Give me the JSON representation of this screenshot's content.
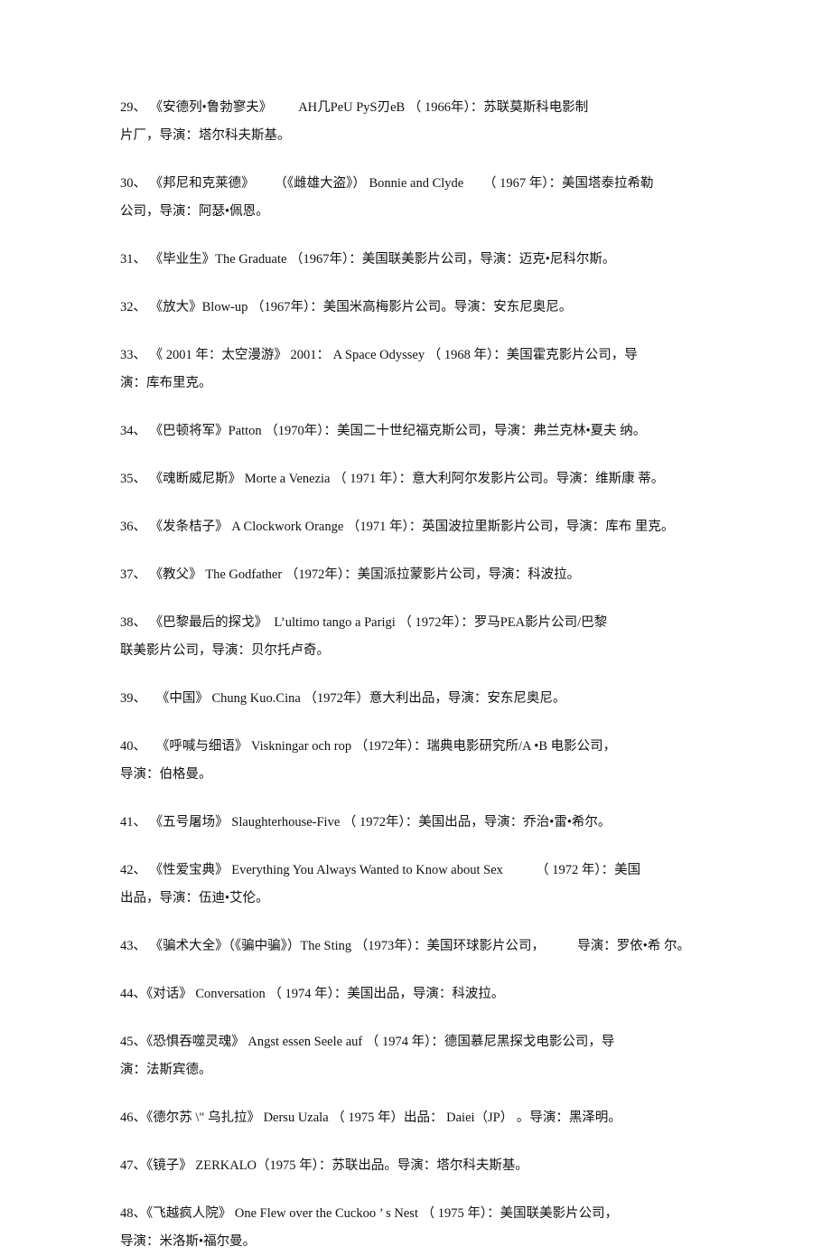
{
  "document": {
    "page_background": "#ffffff",
    "text_color": "#111111",
    "entries": [
      {
        "index": "29、",
        "title_cjk": "《安德列•鲁勃寥夫》",
        "title_latin": "AH几PeU PyS刃eB",
        "year": "（ 1966年）：",
        "line1": "29、 《安德列•鲁勃寥夫》        AH几PeU PyS刃eB （ 1966年）：苏联莫斯科电影制",
        "line2": "片厂，导演：塔尔科夫斯基。"
      },
      {
        "index": "30、",
        "title_cjk": "《邦尼和克莱德》",
        "alt_title_cjk": "（《雌雄大盗》）",
        "title_latin": "Bonnie and Clyde",
        "year": "（ 1967 年）：",
        "line1": "30、 《邦尼和克莱德》      （《雌雄大盗》） Bonnie and Clyde      （ 1967 年）：美国塔泰拉希勒",
        "line2": "公司，导演：阿瑟•佩恩。"
      },
      {
        "index": "31、",
        "title_cjk": "《毕业生》",
        "title_latin": "The Graduate",
        "year": "（1967年）：",
        "line1": "31、 《毕业生》The Graduate （1967年）：美国联美影片公司，导演：迈克•尼科尔斯。",
        "line2": ""
      },
      {
        "index": "32、",
        "title_cjk": "《放大》",
        "title_latin": "Blow-up",
        "year": "（1967年）：",
        "line1": "32、 《放大》Blow-up （1967年）：美国米高梅影片公司。导演：安东尼奥尼。",
        "line2": ""
      },
      {
        "index": "33、",
        "title_cjk": "《 2001 年：太空漫游》",
        "title_latin": "2001： A Space Odyssey",
        "year": "（ 1968 年）：",
        "line1": "33、 《 2001 年：太空漫游》 2001： A Space Odyssey （ 1968 年）：美国霍克影片公司，导",
        "line2": "演：库布里克。"
      },
      {
        "index": "34、",
        "title_cjk": "《巴顿将军》",
        "title_latin": "Patton",
        "year": "（1970年）：",
        "line1": "34、 《巴顿将军》Patton （1970年）：美国二十世纪福克斯公司，导演：弗兰克林•夏夫 纳。",
        "line2": ""
      },
      {
        "index": "35、",
        "title_cjk": "《魂断威尼斯》",
        "title_latin": "Morte a Venezia",
        "year": "（ 1971 年）：",
        "line1": "35、 《魂断威尼斯》 Morte a Venezia （ 1971 年）：意大利阿尔发影片公司。导演：维斯康 蒂。",
        "line2": ""
      },
      {
        "index": "36、",
        "title_cjk": "《发条桔子》",
        "title_latin": "A Clockwork Orange",
        "year": "（1971 年）：",
        "line1": "36、 《发条桔子》 A Clockwork Orange （1971 年）：英国波拉里斯影片公司，导演：库布 里克。",
        "line2": ""
      },
      {
        "index": "37、",
        "title_cjk": "《教父》",
        "title_latin": "The Godfather",
        "year": "（1972年）：",
        "line1": "37、 《教父》 The Godfather （1972年）：美国派拉蒙影片公司，导演：科波拉。",
        "line2": ""
      },
      {
        "index": "38、",
        "title_cjk": "《巴黎最后的探戈》",
        "title_latin": "L’ultimo tango a Parigi",
        "year": "（ 1972年）：",
        "line1": "38、 《巴黎最后的探戈》  L’ultimo tango a Parigi （ 1972年）：罗马PEA影片公司/巴黎",
        "line2": "联美影片公司，导演：贝尔托卢奇。"
      },
      {
        "index": "39、",
        "title_cjk": "《中国》",
        "title_latin": "Chung Kuo.Cina",
        "year": "（1972年）",
        "line1": "39、   《中国》 Chung Kuo.Cina （1972年）意大利出品，导演：安东尼奥尼。",
        "line2": ""
      },
      {
        "index": "40、",
        "title_cjk": "《呼喊与细语》",
        "title_latin": "Viskningar och rop",
        "year": "（1972年）：",
        "line1": "40、   《呼喊与细语》 Viskningar och rop （1972年）：瑞典电影研究所/A •B 电影公司，",
        "line2": "导演：伯格曼。"
      },
      {
        "index": "41、",
        "title_cjk": "《五号屠场》",
        "title_latin": "Slaughterhouse-Five",
        "year": "（ 1972年）：",
        "line1": "41、 《五号屠场》 Slaughterhouse-Five （ 1972年）：美国出品，导演：乔治•雷•希尔。",
        "line2": ""
      },
      {
        "index": "42、",
        "title_cjk": "《性爱宝典》",
        "title_latin": "Everything You Always Wanted to Know about Sex",
        "year": "（ 1972 年）：",
        "line1": "42、 《性爱宝典》 Everything You Always Wanted to Know about Sex          （ 1972 年）：美国",
        "line2": "出品，导演：伍迪•艾伦。"
      },
      {
        "index": "43、",
        "title_cjk": "《骗术大全》",
        "alt_title_cjk": "（《骗中骗》）",
        "title_latin": "The Sting",
        "year": "（1973年）：",
        "line1": "43、 《骗术大全》（《骗中骗》）The Sting （1973年）：美国环球影片公司，          导演：罗依•希 尔。",
        "line2": ""
      },
      {
        "index": "44、",
        "title_cjk": "《对话》",
        "title_latin": "Conversation",
        "year": "（ 1974 年）：",
        "line1": "44、《对话》 Conversation （ 1974 年）：美国出品，导演：科波拉。",
        "line2": ""
      },
      {
        "index": "45、",
        "title_cjk": "《恐惧吞噬灵魂》",
        "title_latin": "Angst essen Seele auf",
        "year": "（ 1974 年）：",
        "line1": "45、《恐惧吞噬灵魂》 Angst essen Seele auf （ 1974 年）：德国慕尼黑探戈电影公司，导",
        "line2": "演：法斯宾德。"
      },
      {
        "index": "46、",
        "title_cjk": "《德尔苏 \\\" 乌扎拉》",
        "title_latin": "Dersu Uzala",
        "year": "（ 1975 年）",
        "line1": "46、《德尔苏 \\\" 乌扎拉》 Dersu Uzala （ 1975 年）出品： Daiei（JP） 。导演：黑泽明。",
        "line2": ""
      },
      {
        "index": "47、",
        "title_cjk": "《镜子》",
        "title_latin": "ZERKALO",
        "year": "（1975 年）：",
        "line1": "47、《镜子》 ZERKALO（1975 年）：苏联出品。导演：塔尔科夫斯基。",
        "line2": ""
      },
      {
        "index": "48、",
        "title_cjk": "《飞越疯人院》",
        "title_latin": "One Flew over the Cuckoo’s Nest",
        "year": "（ 1975 年）：",
        "line1": "48、《飞越疯人院》 One Flew over the Cuckoo ’ s Nest （ 1975 年）：美国联美影片公司，",
        "line2": "导演：米洛斯•福尔曼。"
      }
    ]
  }
}
